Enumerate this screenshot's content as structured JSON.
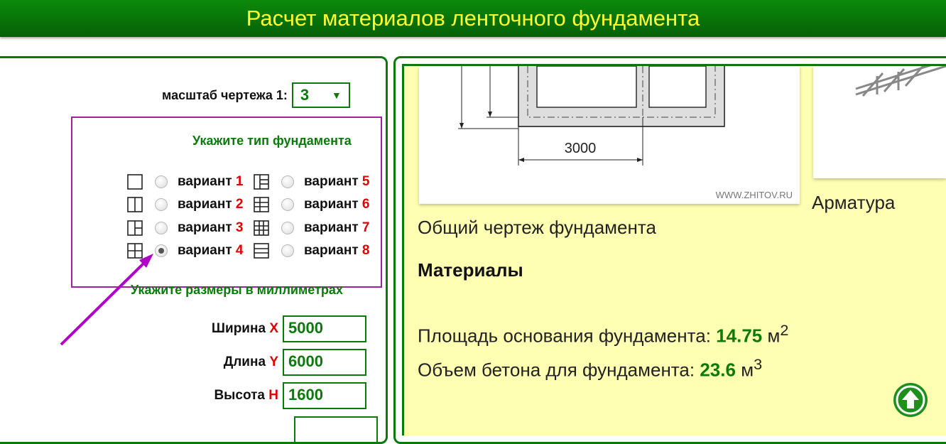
{
  "header": {
    "title": "Расчет материалов ленточного фундамента"
  },
  "scale": {
    "label": "масштаб чертежа 1:",
    "value": "3"
  },
  "foundation_type": {
    "title": "Укажите тип фундамента",
    "word": "вариант",
    "options": [
      {
        "number": "1",
        "icon": "square-plain-icon",
        "checked": false
      },
      {
        "number": "2",
        "icon": "square-vertical-split-icon",
        "checked": false
      },
      {
        "number": "3",
        "icon": "square-t-split-icon",
        "checked": false
      },
      {
        "number": "4",
        "icon": "square-cross-split-icon",
        "checked": true
      },
      {
        "number": "5",
        "icon": "square-three-cell-icon",
        "checked": false
      },
      {
        "number": "6",
        "icon": "square-grid-six-icon",
        "checked": false
      },
      {
        "number": "7",
        "icon": "square-grid-nine-icon",
        "checked": false
      },
      {
        "number": "8",
        "icon": "square-horizontal-lines-icon",
        "checked": false
      }
    ]
  },
  "dimensions": {
    "title": "Укажите размеры в миллиметрах",
    "width": {
      "label": "Ширина",
      "axis": "X",
      "value": "5000"
    },
    "length": {
      "label": "Длина",
      "axis": "Y",
      "value": "6000"
    },
    "height": {
      "label": "Высота",
      "axis": "H",
      "value": "1600"
    }
  },
  "drawing": {
    "dimension_text": "3000",
    "watermark": "WWW.ZHITOV.RU",
    "caption": "Общий чертеж фундамента"
  },
  "rebar": {
    "caption": "Арматура"
  },
  "materials": {
    "title": "Материалы",
    "base_area": {
      "label": "Площадь основания фундамента:",
      "value": "14.75",
      "unit": "м",
      "exp": "2"
    },
    "concrete_volume": {
      "label": "Объем бетона для фундамента:",
      "value": "23.6",
      "unit": "м",
      "exp": "3"
    }
  },
  "colors": {
    "accent": "#0a7a0a",
    "title_yellow": "#ffff33",
    "highlight_red": "#e00000",
    "panel_bg": "#ffffb3",
    "frame_purple": "#a020a0",
    "arrow_purple": "#b000c8"
  }
}
